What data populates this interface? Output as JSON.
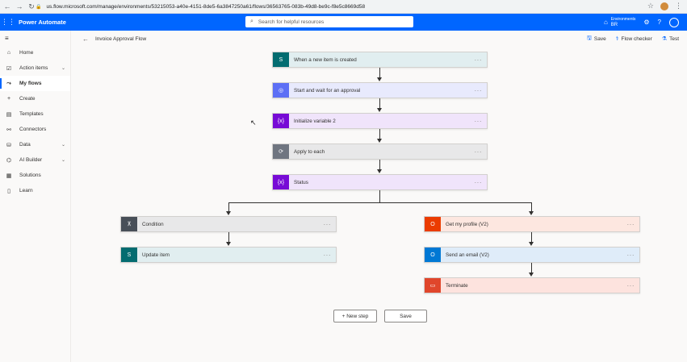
{
  "browser": {
    "url": "us.flow.microsoft.com/manage/environments/53215053-a40e-4151-8de5-6a3847250a61/flows/36563765-083b-49d8-be9c-f8e5c8669d58",
    "back_icon": "arrow-left-icon",
    "forward_icon": "arrow-right-icon",
    "reload_icon": "reload-icon"
  },
  "header": {
    "app_title": "Power Automate",
    "search_placeholder": "Search for helpful resources",
    "env_label": "Environments",
    "env_value": "BR",
    "brand_color": "#0066ff"
  },
  "sidebar": {
    "items": [
      {
        "label": "Home",
        "icon": "home-icon",
        "chevron": false,
        "active": false
      },
      {
        "label": "Action items",
        "icon": "checklist-icon",
        "chevron": true,
        "active": false
      },
      {
        "label": "My flows",
        "icon": "flow-icon",
        "chevron": false,
        "active": true
      },
      {
        "label": "Create",
        "icon": "plus-icon",
        "chevron": false,
        "active": false
      },
      {
        "label": "Templates",
        "icon": "templates-icon",
        "chevron": false,
        "active": false
      },
      {
        "label": "Connectors",
        "icon": "connector-icon",
        "chevron": false,
        "active": false
      },
      {
        "label": "Data",
        "icon": "database-icon",
        "chevron": true,
        "active": false
      },
      {
        "label": "AI Builder",
        "icon": "ai-builder-icon",
        "chevron": true,
        "active": false
      },
      {
        "label": "Solutions",
        "icon": "solutions-icon",
        "chevron": false,
        "active": false
      },
      {
        "label": "Learn",
        "icon": "book-icon",
        "chevron": false,
        "active": false
      }
    ]
  },
  "command_bar": {
    "flow_name": "Invoice Approval Flow",
    "save": "Save",
    "flow_checker": "Flow checker",
    "test": "Test"
  },
  "steps": {
    "trigger": {
      "title": "When a new item is created",
      "color": "#036c70",
      "bg": "#e1eef0",
      "glyph": "S"
    },
    "approval": {
      "title": "Start and wait for an approval",
      "color": "#5c6ff5",
      "bg": "#e8eafd",
      "glyph": "◎"
    },
    "init_var": {
      "title": "Initialize variable 2",
      "color": "#770bd6",
      "bg": "#f0e4fb",
      "glyph": "{x}"
    },
    "apply_each": {
      "title": "Apply to each",
      "color": "#6f7580",
      "bg": "#e8e8e9",
      "glyph": "⟳"
    },
    "status": {
      "title": "Status",
      "color": "#770bd6",
      "bg": "#f0e4fb",
      "glyph": "{x}"
    },
    "condition": {
      "title": "Condition",
      "color": "#484f58",
      "bg": "#e8e8e9",
      "glyph": "⊼"
    },
    "update_item": {
      "title": "Update item",
      "color": "#036c70",
      "bg": "#e1eef0",
      "glyph": "S"
    },
    "get_profile": {
      "title": "Get my profile (V2)",
      "color": "#eb3c00",
      "bg": "#fde7e0",
      "glyph": "O"
    },
    "send_email": {
      "title": "Send an email (V2)",
      "color": "#0078d4",
      "bg": "#dfecf9",
      "glyph": "O"
    },
    "terminate": {
      "title": "Terminate",
      "color": "#e0462b",
      "bg": "#fde3de",
      "glyph": "▭"
    }
  },
  "dots_label": "···",
  "footer": {
    "new_step": "+ New step",
    "save": "Save"
  }
}
